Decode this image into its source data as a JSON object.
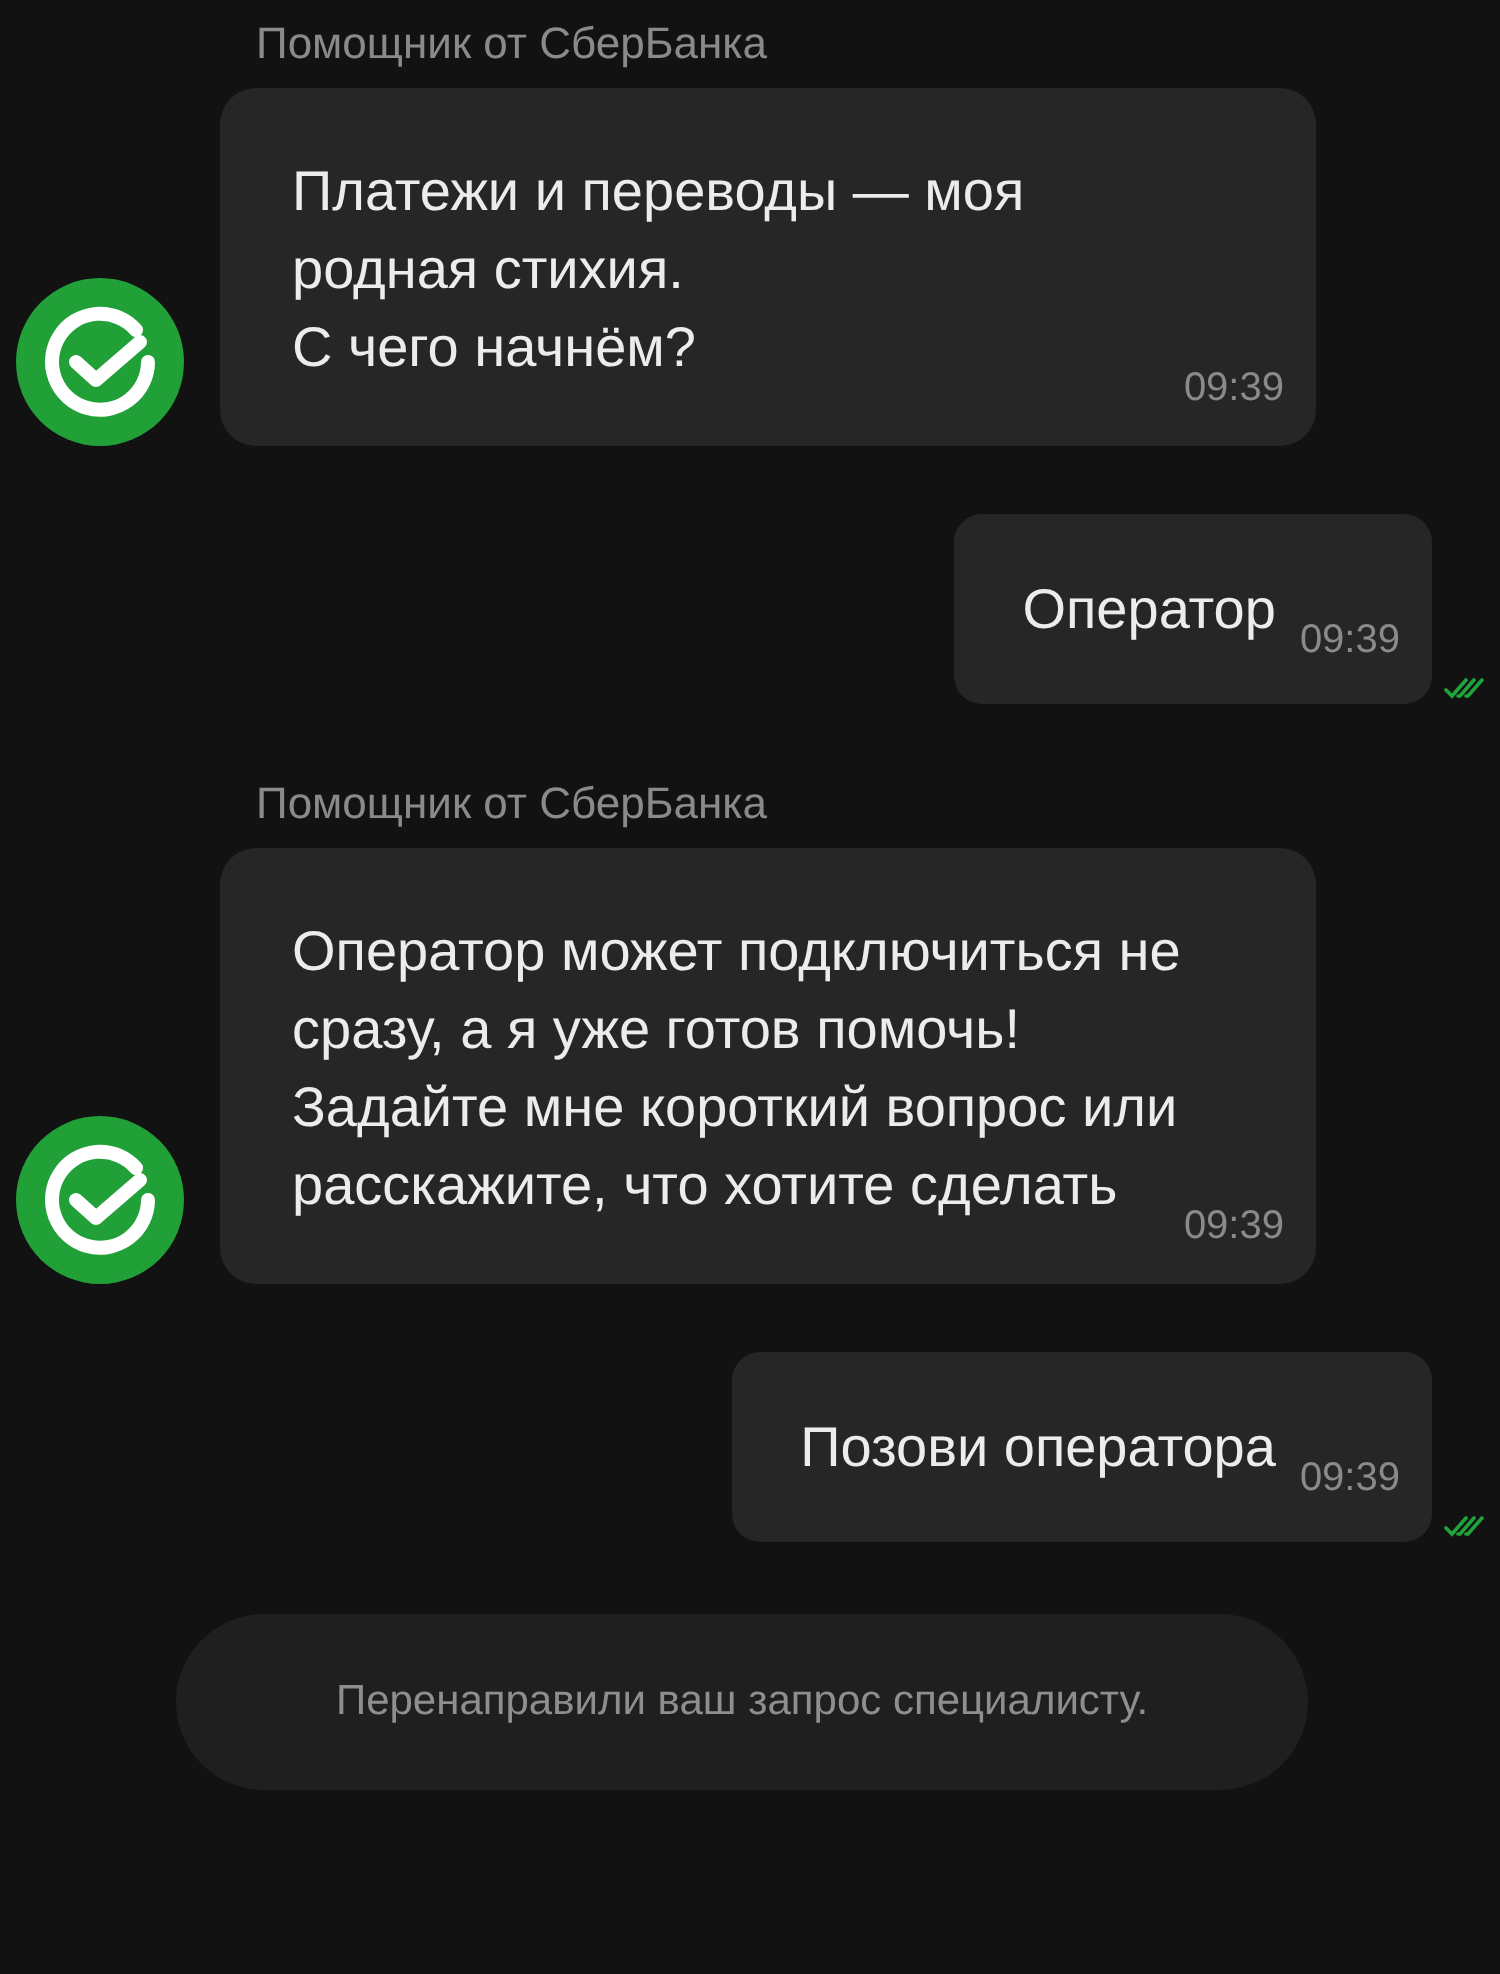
{
  "messages": [
    {
      "kind": "bot",
      "sender": "Помощник от СберБанка",
      "text": "Платежи и переводы — моя\nродная стихия.\nС чего начнём?",
      "time": "09:39"
    },
    {
      "kind": "user",
      "text": "Оператор",
      "time": "09:39",
      "read": true
    },
    {
      "kind": "bot",
      "sender": "Помощник от СберБанка",
      "text": "Оператор может подключиться не сразу, а я уже готов помочь! Задайте мне короткий вопрос или расскажите, что хотите сделать",
      "time": "09:39"
    },
    {
      "kind": "user",
      "text": "Позови оператора",
      "time": "09:39",
      "read": true
    },
    {
      "kind": "system",
      "text": "Перенаправили ваш запрос специалисту."
    }
  ]
}
